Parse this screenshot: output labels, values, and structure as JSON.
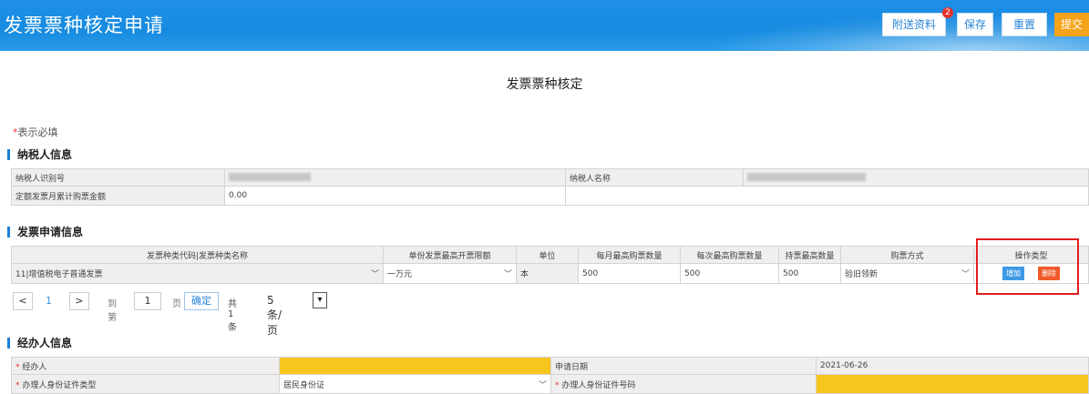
{
  "header": {
    "title": "发票票种核定申请",
    "buttons": {
      "attachments": "附送资料",
      "attachments_badge": "2",
      "save": "保存",
      "reset": "重置",
      "submit": "提交"
    }
  },
  "page_title": "发票票种核定",
  "required_note": {
    "star": "*",
    "text": "表示必填"
  },
  "taxpayer": {
    "section_title": "纳税人信息",
    "id_label": "纳税人识别号",
    "name_label": "纳税人名称",
    "quota_label": "定额发票月累计购票金额",
    "quota_value": "0.00"
  },
  "invoice": {
    "section_title": "发票申请信息",
    "headers": [
      "发票种类代码|发票种类名称",
      "单份发票最高开票限额",
      "单位",
      "每月最高购票数量",
      "每次最高购票数量",
      "持票最高数量",
      "购票方式",
      "操作类型"
    ],
    "row": {
      "type": "11|增值税电子普通发票",
      "limit": "一万元",
      "unit": "本",
      "monthly": "500",
      "per_time": "500",
      "hold": "500",
      "method": "验旧领新",
      "add_label": "增加",
      "delete_label": "删除"
    }
  },
  "pager": {
    "prev": "<",
    "current": "1",
    "next": ">",
    "goto_label": "到第",
    "goto_value": "1",
    "page_unit": "页",
    "confirm": "确定",
    "total": "共 1 条",
    "page_size": "5 条/页"
  },
  "agent": {
    "section_title": "经办人信息",
    "agent_label": "经办人",
    "date_label": "申请日期",
    "date_value": "2021-06-26",
    "id_type_label": "办理人身份证件类型",
    "id_type_value": "居民身份证",
    "id_number_label": "办理人身份证件号码"
  },
  "colors": {
    "header": "#1f8fe8",
    "submit": "#f5a31a",
    "add": "#3f9ae6",
    "delete": "#f05a2a",
    "highlight": "#e31e1e",
    "required_field": "#f8c51e"
  }
}
